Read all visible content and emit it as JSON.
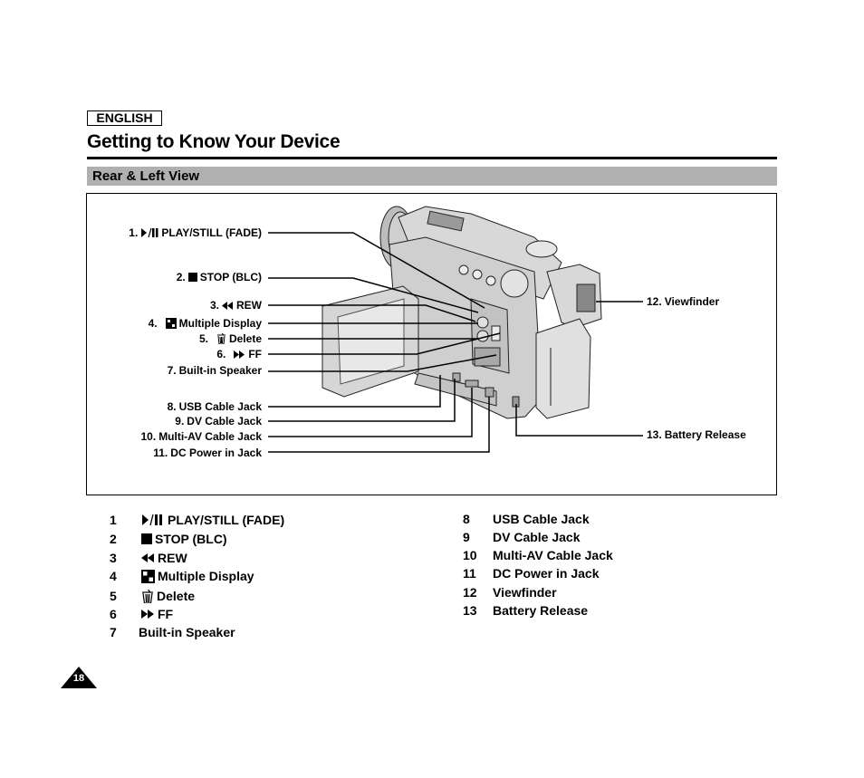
{
  "header": {
    "language_badge": "ENGLISH",
    "page_title": "Getting to Know Your Device"
  },
  "section": {
    "title": "Rear & Left View"
  },
  "figure": {
    "subject": "camcorder-rear-left-view",
    "callouts_left": [
      {
        "num": "1.",
        "icon": "play-pause-icon",
        "label": "PLAY/STILL (FADE)"
      },
      {
        "num": "2.",
        "icon": "stop-icon",
        "label": "STOP (BLC)"
      },
      {
        "num": "3.",
        "icon": "rewind-icon",
        "label": "REW"
      },
      {
        "num": "4.",
        "icon": "multiple-display-icon",
        "label": "Multiple Display"
      },
      {
        "num": "5.",
        "icon": "trash-icon",
        "label": "Delete"
      },
      {
        "num": "6.",
        "icon": "fast-forward-icon",
        "label": "FF"
      },
      {
        "num": "7.",
        "icon": "",
        "label": "Built-in Speaker"
      },
      {
        "num": "8.",
        "icon": "",
        "label": "USB Cable Jack"
      },
      {
        "num": "9.",
        "icon": "",
        "label": "DV Cable Jack"
      },
      {
        "num": "10.",
        "icon": "",
        "label": "Multi-AV Cable Jack"
      },
      {
        "num": "11.",
        "icon": "",
        "label": "DC Power in Jack"
      }
    ],
    "callouts_right": [
      {
        "num": "12.",
        "label": "Viewfinder"
      },
      {
        "num": "13.",
        "label": "Battery Release"
      }
    ]
  },
  "legend": {
    "column1": [
      {
        "num": "1",
        "icon": "play-pause-icon",
        "label": "PLAY/STILL (FADE)"
      },
      {
        "num": "2",
        "icon": "stop-icon",
        "label": "STOP (BLC)"
      },
      {
        "num": "3",
        "icon": "rewind-icon",
        "label": "REW"
      },
      {
        "num": "4",
        "icon": "multiple-display-icon",
        "label": "Multiple Display"
      },
      {
        "num": "5",
        "icon": "trash-icon",
        "label": "Delete"
      },
      {
        "num": "6",
        "icon": "fast-forward-icon",
        "label": "FF"
      },
      {
        "num": "7",
        "icon": "",
        "label": "Built-in Speaker"
      }
    ],
    "column2": [
      {
        "num": "8",
        "label": "USB Cable Jack"
      },
      {
        "num": "9",
        "label": "DV Cable Jack"
      },
      {
        "num": "10",
        "label": "Multi-AV Cable Jack"
      },
      {
        "num": "11",
        "label": "DC Power in Jack"
      },
      {
        "num": "12",
        "label": "Viewfinder"
      },
      {
        "num": "13",
        "label": "Battery Release"
      }
    ]
  },
  "footer": {
    "page_number": "18"
  },
  "colors": {
    "section_bar": "#b0b0b0",
    "text": "#000000",
    "camera_body": "#d4d4d4"
  }
}
